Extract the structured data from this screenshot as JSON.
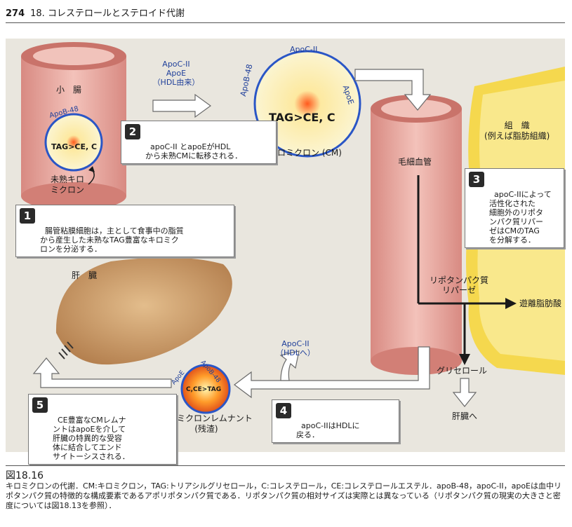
{
  "header": {
    "page_number": "274",
    "chapter": "18. コレステロールとステロイド代謝"
  },
  "diagram": {
    "intestine": {
      "label": "小　腸",
      "apob48": "ApoB-48",
      "core": "TAG>CE, C",
      "immature": "未熟キロ\nミクロン"
    },
    "transfer": {
      "text": "ApoC-II\nApoE\n（HDL由来）"
    },
    "cm": {
      "apoc2": "ApoC-II",
      "apob48": "ApoB-48",
      "apoe": "ApoE",
      "core": "TAG>CE, C",
      "name": "キロミクロン (CM)"
    },
    "capillary": "毛細血管",
    "tissue": "組　織\n(例えば脂肪組織)",
    "lipase": "リポタンパク質\nリパーゼ",
    "free_fa": "遊離脂肪酸",
    "glycerol": "グリセロール",
    "to_liver": "肝臓へ",
    "liver": "肝　臓",
    "return_hdl": "ApoC-II\n（HDLへ）",
    "remnant": {
      "apoe": "ApoE",
      "apob48": "ApoB-48",
      "core": "C,CE>TAG",
      "name": "キロミクロンレムナント\n(残渣)"
    },
    "steps": [
      {
        "num": "1",
        "text": "腸管粘膜細胞は，主として食事中の脂質\nから産生した未熟なTAG豊富なキロミク\nロンを分泌する．"
      },
      {
        "num": "2",
        "text": "apoC-II とapoEがHDL\nから未熟CMに転移される．"
      },
      {
        "num": "3",
        "text": "apoC-IIによって\n活性化された\n細胞外のリポタ\nンパク質リパー\nゼはCMのTAG\nを分解する．"
      },
      {
        "num": "4",
        "text": "apoC-IIはHDLに\n戻る．"
      },
      {
        "num": "5",
        "text": "CE豊富なCMレムナ\nントはapoEを介して\n肝臓の特異的な受容\n体に結合してエンド\nサイトーシスされる．"
      }
    ]
  },
  "caption": {
    "title": "図18.16",
    "text": "キロミクロンの代謝．CM:キロミクロン，TAG:トリアシルグリセロール，C:コレステロール，CE:コレステロールエステル．apoB-48，apoC-II，apoEは血中リポタンパク質の特徴的な構成要素であるアポリポタンパク質である．リポタンパク質の相対サイズは実際とは異なっている（リポタンパク質の現実の大きさと密度については図18.13を参照）．"
  },
  "colors": {
    "panel": "#e9e6de",
    "vessel": "#e9a9a1",
    "tissue": "#f4d64a",
    "liver": "#c79a66",
    "particle": "#fbf3c4",
    "ring": "#2a56c6",
    "label_blue": "#1f3f9a"
  }
}
